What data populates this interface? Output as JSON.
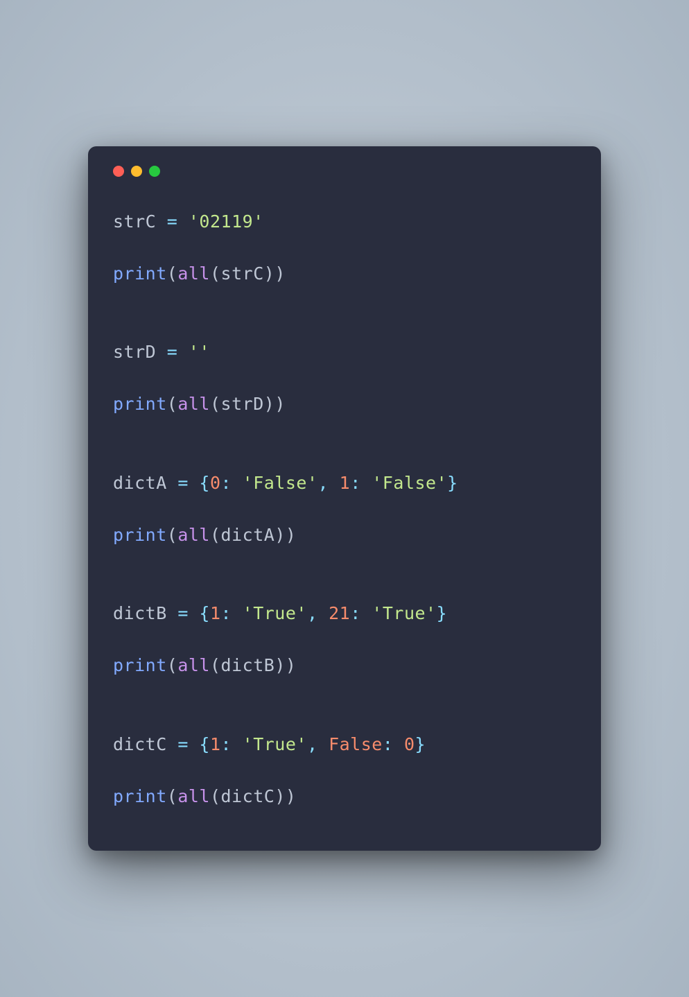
{
  "code": {
    "blocks": [
      {
        "assign": {
          "varName": "strC",
          "value": "'02119'",
          "valueClass": "t-str"
        },
        "print": {
          "arg": "strC"
        }
      },
      {
        "assign": {
          "varName": "strD",
          "value": "''",
          "valueClass": "t-str"
        },
        "print": {
          "arg": "strD"
        }
      },
      {
        "assign": {
          "varName": "dictA",
          "dict": [
            {
              "key": "0",
              "keyClass": "t-num",
              "val": "'False'",
              "valClass": "t-str"
            },
            {
              "key": "1",
              "keyClass": "t-num",
              "val": "'False'",
              "valClass": "t-str"
            }
          ]
        },
        "print": {
          "arg": "dictA"
        }
      },
      {
        "assign": {
          "varName": "dictB",
          "dict": [
            {
              "key": "1",
              "keyClass": "t-num",
              "val": "'True'",
              "valClass": "t-str"
            },
            {
              "key": "21",
              "keyClass": "t-num",
              "val": "'True'",
              "valClass": "t-str"
            }
          ]
        },
        "print": {
          "arg": "dictB"
        }
      },
      {
        "assign": {
          "varName": "dictC",
          "dict": [
            {
              "key": "1",
              "keyClass": "t-num",
              "val": "'True'",
              "valClass": "t-str"
            },
            {
              "key": "False",
              "keyClass": "t-num",
              "val": "0",
              "valClass": "t-num"
            }
          ]
        },
        "print": {
          "arg": "dictC"
        }
      }
    ],
    "tokens": {
      "equals": " = ",
      "print": "print",
      "all": "all",
      "lparen": "(",
      "rparen": ")",
      "lbrace": "{",
      "rbrace": "}",
      "colon": ": ",
      "comma": ", "
    }
  }
}
